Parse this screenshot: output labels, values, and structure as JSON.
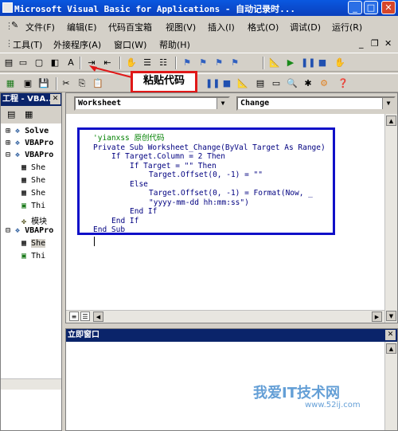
{
  "titlebar": {
    "title": "Microsoft Visual Basic for Applications - 自动记录时...",
    "min": "_",
    "max": "□",
    "close": "✕"
  },
  "menu1": [
    {
      "label": "文件(F)"
    },
    {
      "label": "编辑(E)"
    },
    {
      "label": "代码百宝箱"
    },
    {
      "label": "视图(V)"
    },
    {
      "label": "插入(I)"
    },
    {
      "label": "格式(O)"
    },
    {
      "label": "调试(D)"
    },
    {
      "label": "运行(R)"
    }
  ],
  "menu2": [
    {
      "label": "工具(T)"
    },
    {
      "label": "外接程序(A)"
    },
    {
      "label": "窗口(W)"
    },
    {
      "label": "帮助(H)"
    }
  ],
  "menu2_controls": {
    "min": "_",
    "restore": "❐",
    "close": "✕"
  },
  "callout": {
    "text": "粘贴代码"
  },
  "project": {
    "title": "工程 - VBA...",
    "items": [
      {
        "label": "Solve"
      },
      {
        "label": "VBAPro"
      },
      {
        "label": "VBAPro"
      },
      {
        "label": "She"
      },
      {
        "label": "She"
      },
      {
        "label": "She"
      },
      {
        "label": "Thi"
      },
      {
        "label": "模块"
      },
      {
        "label": "VBAPro"
      },
      {
        "label": "She"
      },
      {
        "label": "Thi"
      }
    ]
  },
  "editor": {
    "object_combo": "Worksheet",
    "proc_combo": "Change",
    "code": {
      "l1": "'yianxss 原创代码",
      "l2": "Private Sub Worksheet_Change(ByVal Target As Range)",
      "l3": "If Target.Column = 2 Then",
      "l4": "If Target = \"\" Then",
      "l5": "Target.Offset(0, -1) = \"\"",
      "l6": "Else",
      "l7": "Target.Offset(0, -1) = Format(Now, _",
      "l8": "\"yyyy-mm-dd hh:mm:ss\")",
      "l9": "End If",
      "l10": "End If",
      "l11": "End Sub"
    }
  },
  "immediate": {
    "title": "立即窗口"
  },
  "watermark": {
    "text": "我爱IT技术网",
    "url": "www.52ij.com"
  },
  "colors": {
    "callout_border": "#e01818",
    "highlight_border": "#1010c8",
    "title_blue": "#0a3fbc"
  }
}
